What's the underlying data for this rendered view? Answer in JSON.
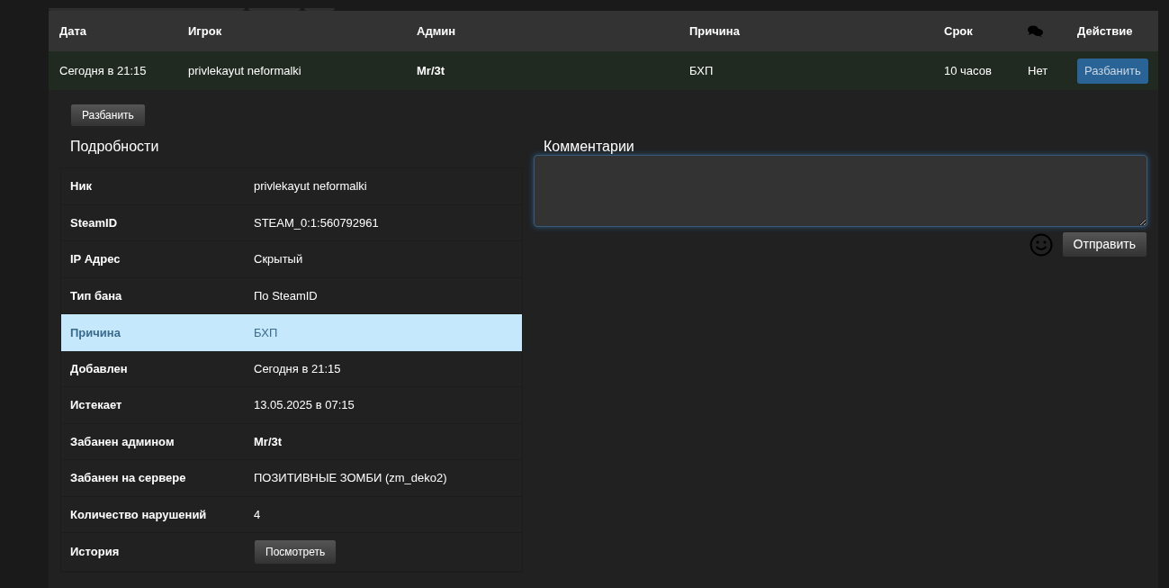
{
  "table": {
    "columns": [
      {
        "kind": "text",
        "label": "Дата"
      },
      {
        "kind": "text",
        "label": "Игрок"
      },
      {
        "kind": "text",
        "label": "Админ"
      },
      {
        "kind": "text",
        "label": "Причина"
      },
      {
        "kind": "text",
        "label": "Срок"
      },
      {
        "kind": "icon"
      },
      {
        "kind": "text",
        "label": "Действие"
      }
    ],
    "rows": [
      {
        "cells": [
          {
            "kind": "text",
            "text": "Сегодня в 21:15",
            "bold": false
          },
          {
            "kind": "text",
            "text": "privlekayut neformalki",
            "bold": false
          },
          {
            "kind": "text",
            "text": "Mr/3t",
            "bold": true
          },
          {
            "kind": "text",
            "text": "БХП",
            "bold": false
          },
          {
            "kind": "text",
            "text": "10 часов",
            "bold": false
          },
          {
            "kind": "text",
            "text": "Нет",
            "bold": false
          },
          {
            "kind": "button",
            "text": "Разбанить"
          }
        ]
      }
    ]
  },
  "unban_button": "Разбанить",
  "details": {
    "title": "Подробности",
    "rows": [
      {
        "label": "Ник",
        "kind": "text",
        "value": "privlekayut neformalki",
        "bold": false,
        "selected": false
      },
      {
        "label": "SteamID",
        "kind": "text",
        "value": "STEAM_0:1:560792961",
        "bold": false,
        "selected": false
      },
      {
        "label": "IP Адрес",
        "kind": "text",
        "value": "Скрытый",
        "bold": false,
        "selected": false
      },
      {
        "label": "Тип бана",
        "kind": "text",
        "value": "По SteamID",
        "bold": false,
        "selected": false
      },
      {
        "label": "Причина",
        "kind": "text",
        "value": "БХП",
        "bold": false,
        "selected": true
      },
      {
        "label": "Добавлен",
        "kind": "text",
        "value": "Сегодня в 21:15",
        "bold": false,
        "selected": false
      },
      {
        "label": "Истекает",
        "kind": "text",
        "value": "13.05.2025 в 07:15",
        "bold": false,
        "selected": false
      },
      {
        "label": "Забанен админом",
        "kind": "text",
        "value": "Mr/3t",
        "bold": true,
        "selected": false
      },
      {
        "label": "Забанен на сервере",
        "kind": "text",
        "value": "ПОЗИТИВНЫЕ ЗОМБИ (zm_deko2)",
        "bold": false,
        "selected": false
      },
      {
        "label": "Количество нарушений",
        "kind": "text",
        "value": "4",
        "bold": false,
        "selected": false
      },
      {
        "label": "История",
        "kind": "button",
        "value": "Посмотреть",
        "selected": false
      }
    ]
  },
  "comments": {
    "title": "Комментарии",
    "send_button": "Отправить"
  }
}
